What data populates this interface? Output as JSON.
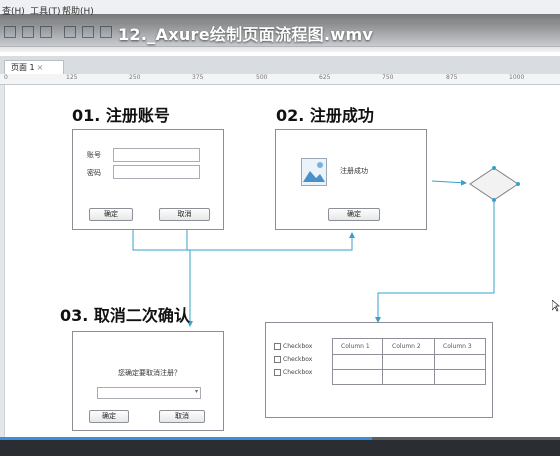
{
  "video": {
    "title": "12._Axure绘制页面流程图.wmv",
    "progress_fraction": 0.665
  },
  "menu": {
    "items": [
      "查(H)",
      "工具(T)",
      "帮助(H)"
    ]
  },
  "tabs": [
    {
      "label": "页面 1",
      "close": "×"
    }
  ],
  "ruler": {
    "ticks": [
      "0",
      "125",
      "250",
      "375",
      "500",
      "625",
      "750",
      "875",
      "1000"
    ]
  },
  "flow": {
    "register": {
      "heading": "01. 注册账号",
      "account_label": "账号",
      "password_label": "密码",
      "confirm_button": "确定",
      "cancel_button": "取消"
    },
    "success": {
      "heading": "02. 注册成功",
      "message": "注册成功",
      "confirm_button": "确定"
    },
    "cancel_confirm": {
      "heading": "03. 取消二次确认",
      "question": "您确定要取消注册？",
      "confirm_button": "确定",
      "cancel_button": "取消"
    },
    "table_widget": {
      "checkboxes": [
        "Checkbox",
        "Checkbox",
        "Checkbox"
      ],
      "columns": [
        "Column 1",
        "Column 2",
        "Column 3"
      ]
    }
  },
  "colors": {
    "connector": "#3aa0c8",
    "progress": "#3b8de0"
  }
}
